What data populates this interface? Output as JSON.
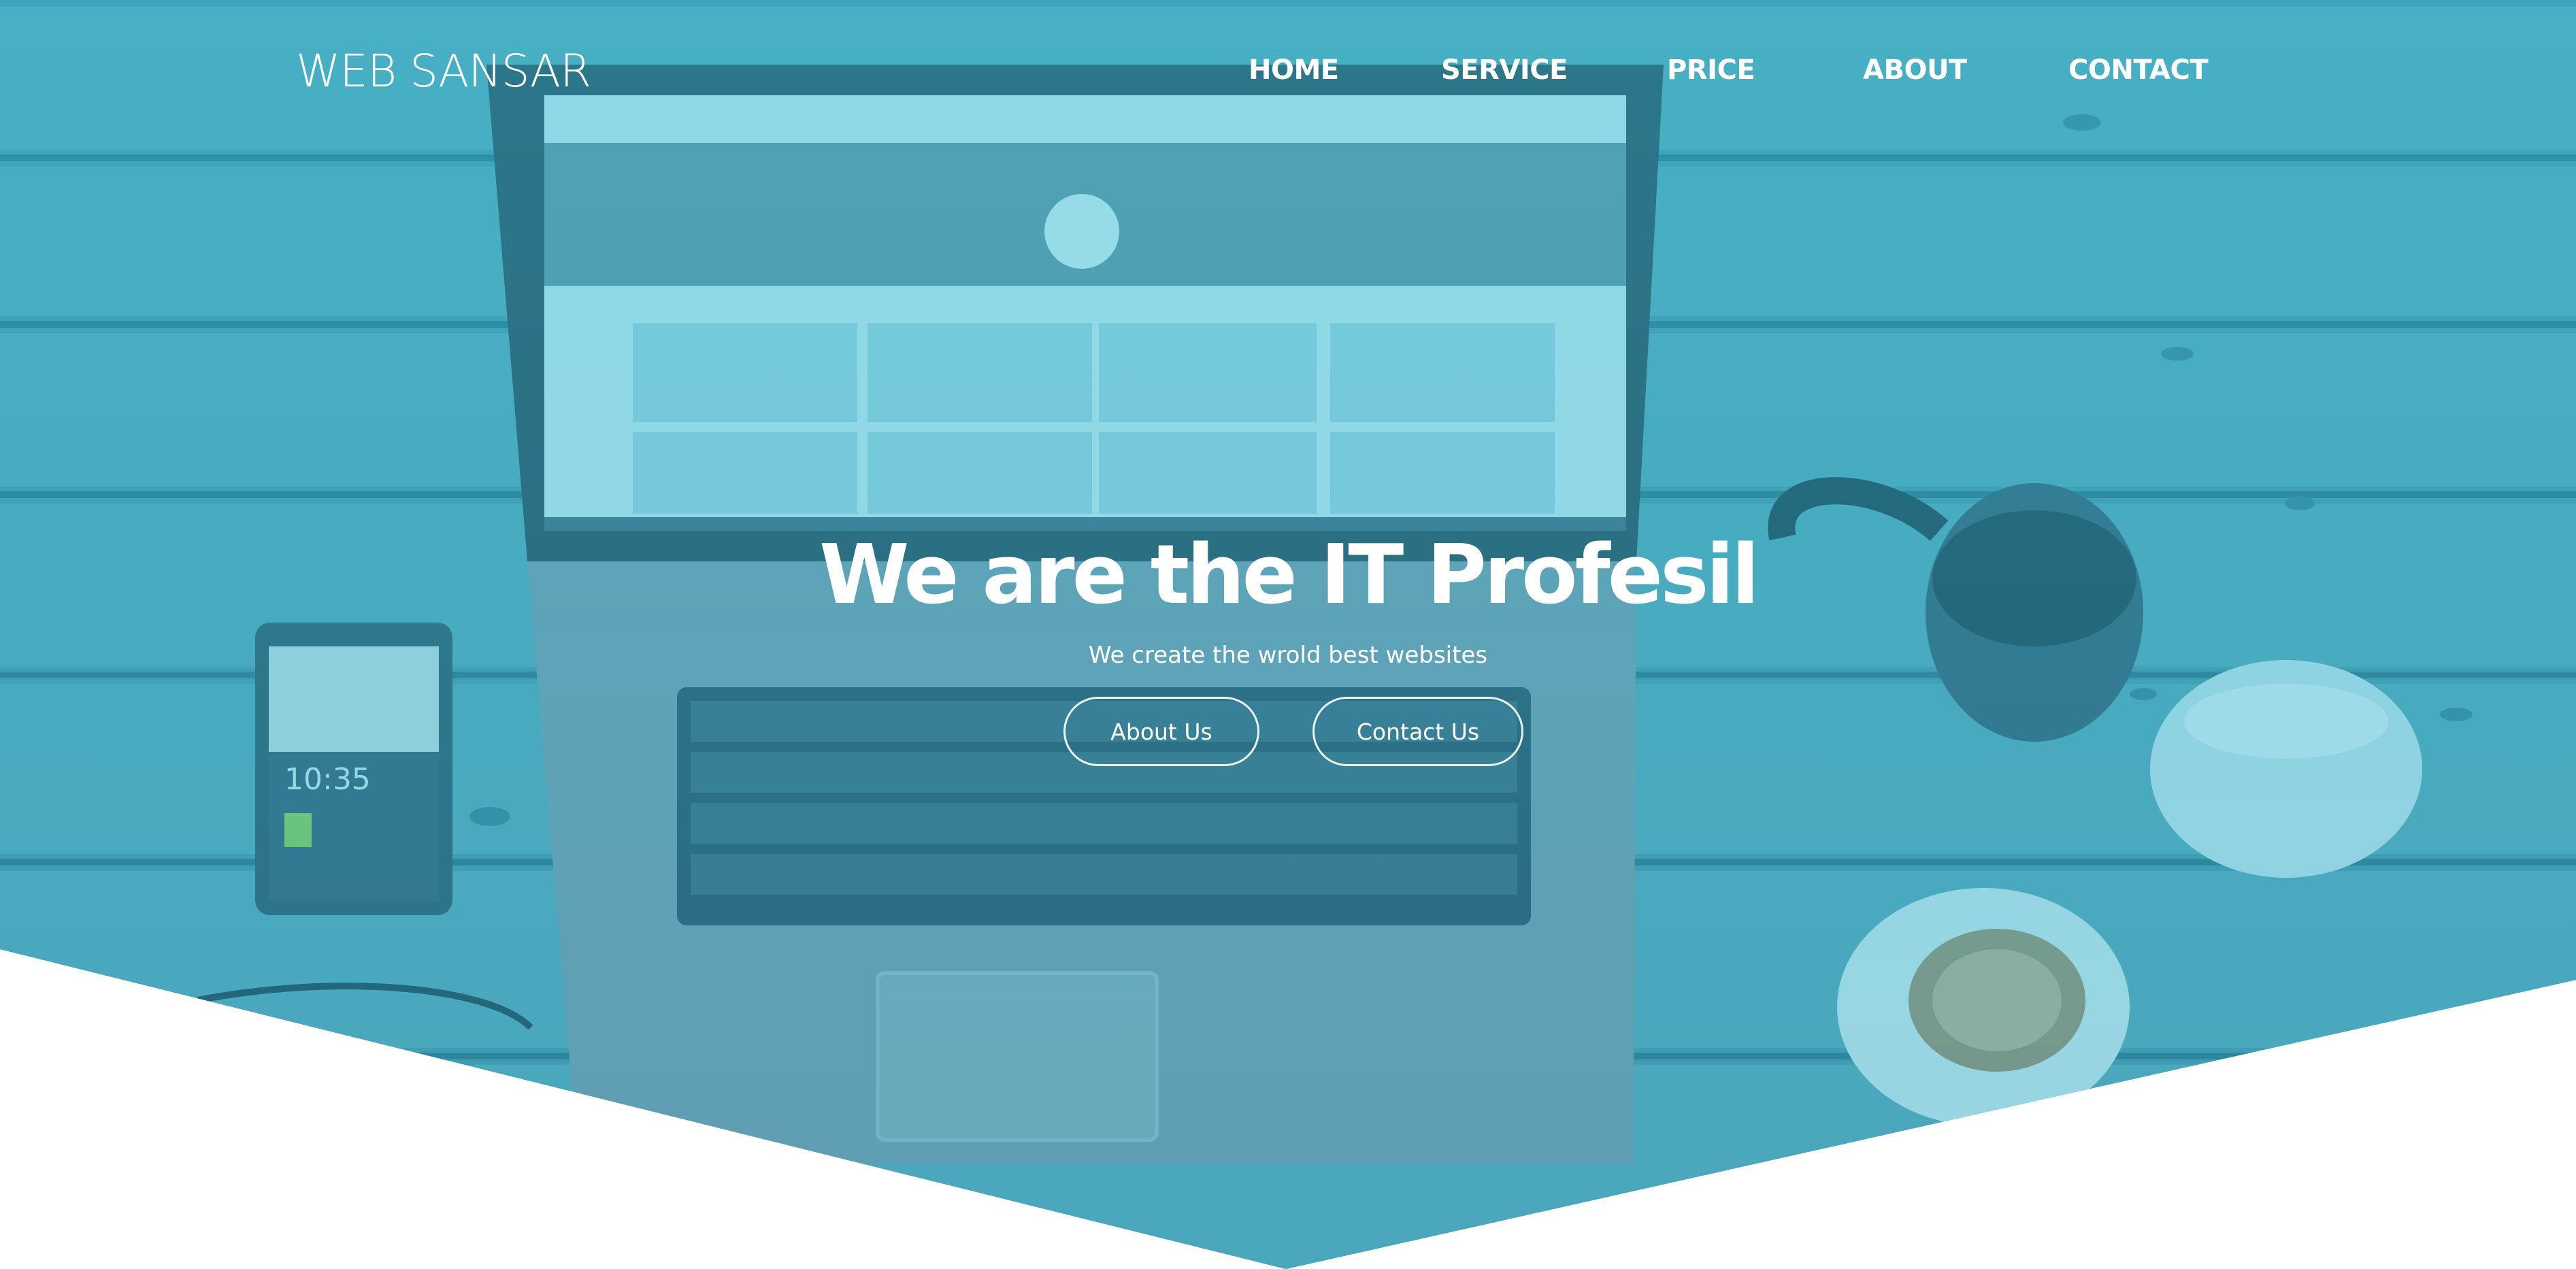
{
  "brand": {
    "name": "WEB SANSAR"
  },
  "nav": {
    "items": [
      {
        "label": "HOME"
      },
      {
        "label": "SERVICE"
      },
      {
        "label": "PRICE"
      },
      {
        "label": "ABOUT"
      },
      {
        "label": "CONTACT"
      }
    ]
  },
  "hero": {
    "headline": "We are the IT Profesil",
    "subheadline": "We create the wrold best websites",
    "buttons": {
      "about": "About Us",
      "contact": "Contact Us"
    }
  },
  "colors": {
    "overlay_tint": "#2dbed7",
    "text": "#ffffff",
    "below_hero_background": "#ffffff"
  }
}
